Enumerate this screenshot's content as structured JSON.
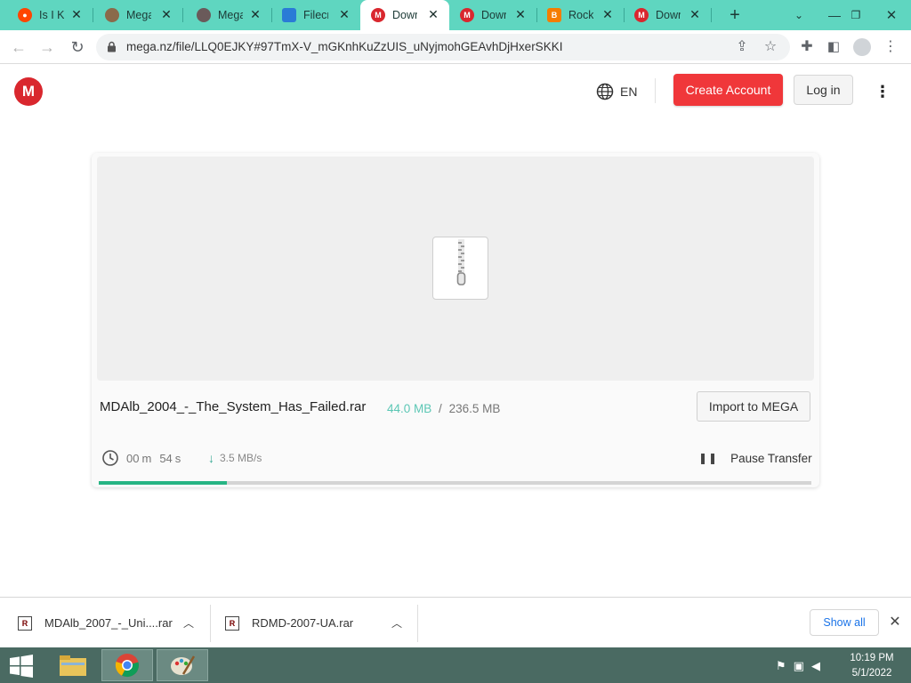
{
  "browser": {
    "tabs": [
      {
        "title": "Is I Kn",
        "favicon": "reddit-icon",
        "color": "#ff4500"
      },
      {
        "title": "Mega",
        "favicon": "avatar-icon",
        "color": "#8a6a4a"
      },
      {
        "title": "Mega",
        "favicon": "avatar-icon",
        "color": "#6a5a5a"
      },
      {
        "title": "Filecry",
        "favicon": "shield-icon",
        "color": "#2a7bd6"
      },
      {
        "title": "Downl",
        "favicon": "mega-icon",
        "color": "#d9272e"
      },
      {
        "title": "Downl",
        "favicon": "mega-icon",
        "color": "#d9272e"
      },
      {
        "title": "Rock I",
        "favicon": "blogger-icon",
        "color": "#f57d00"
      },
      {
        "title": "Downl",
        "favicon": "mega-icon",
        "color": "#d9272e"
      }
    ],
    "active_tab": 4,
    "url": "mega.nz/file/LLQ0EJKY#97TmX-V_mGKnhKuZzUIS_uNyjmohGEAvhDjHxerSKKI"
  },
  "mega": {
    "logo_letter": "M",
    "language": "EN",
    "create_account": "Create Account",
    "login": "Log in"
  },
  "file": {
    "name": "MDAlb_2004_-_The_System_Has_Failed.rar",
    "downloaded": "44.0 MB",
    "separator": "/",
    "total": "236.5 MB",
    "import_label": "Import to MEGA",
    "time_min": "00",
    "time_min_unit": "m",
    "time_sec": "54",
    "time_sec_unit": "s",
    "speed": "3.5 MB/s",
    "pause_label": "Pause Transfer",
    "progress_fraction": 0.18
  },
  "shelf": {
    "items": [
      {
        "name": "MDAlb_2007_-_Uni....rar"
      },
      {
        "name": "RDMD-2007-UA.rar"
      }
    ],
    "show_all": "Show all"
  },
  "taskbar": {
    "time": "10:19 PM",
    "date": "5/1/2022"
  },
  "colors": {
    "tab_strip": "#5fd6c0",
    "mega_red": "#d9272e",
    "create_button": "#f0373a",
    "progress": "#27b584",
    "downloaded_text": "#5cc7b5"
  }
}
